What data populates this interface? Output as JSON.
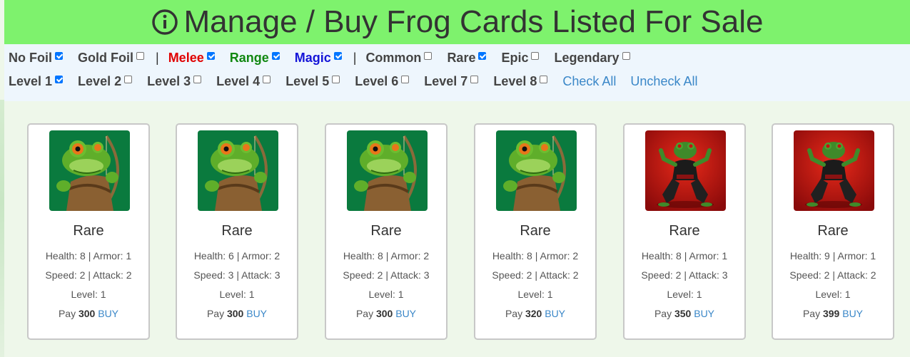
{
  "header": {
    "title": "Manage / Buy Frog Cards Listed For Sale",
    "icon": "info-circle-icon"
  },
  "filters": {
    "row1": [
      {
        "label": "No Foil",
        "checked": true,
        "color": "#444444"
      },
      {
        "label": "Gold Foil",
        "checked": false,
        "color": "#444444"
      },
      {
        "sep": "|"
      },
      {
        "label": "Melee",
        "checked": true,
        "color": "#e00000"
      },
      {
        "label": "Range",
        "checked": true,
        "color": "#118811"
      },
      {
        "label": "Magic",
        "checked": true,
        "color": "#1515d8"
      },
      {
        "sep": "|"
      },
      {
        "label": "Common",
        "checked": false,
        "color": "#444444"
      },
      {
        "label": "Rare",
        "checked": true,
        "color": "#444444"
      },
      {
        "label": "Epic",
        "checked": false,
        "color": "#444444"
      },
      {
        "label": "Legendary",
        "checked": false,
        "color": "#444444"
      }
    ],
    "row2": [
      {
        "label": "Level 1",
        "checked": true
      },
      {
        "label": "Level 2",
        "checked": false
      },
      {
        "label": "Level 3",
        "checked": false
      },
      {
        "label": "Level 4",
        "checked": false
      },
      {
        "label": "Level 5",
        "checked": false
      },
      {
        "label": "Level 6",
        "checked": false
      },
      {
        "label": "Level 7",
        "checked": false
      },
      {
        "label": "Level 8",
        "checked": false
      }
    ],
    "check_all": "Check All",
    "uncheck_all": "Uncheck All"
  },
  "cards": [
    {
      "art": "archer-frog-icon",
      "rarity": "Rare",
      "health_armor": "Health: 8 | Armor: 1",
      "speed_attack": "Speed: 2 | Attack: 2",
      "level": "Level: 1",
      "pay_label": "Pay",
      "price": "300",
      "buy": "BUY"
    },
    {
      "art": "archer-frog-icon",
      "rarity": "Rare",
      "health_armor": "Health: 6 | Armor: 2",
      "speed_attack": "Speed: 3 | Attack: 3",
      "level": "Level: 1",
      "pay_label": "Pay",
      "price": "300",
      "buy": "BUY"
    },
    {
      "art": "archer-frog-icon",
      "rarity": "Rare",
      "health_armor": "Health: 8 | Armor: 2",
      "speed_attack": "Speed: 2 | Attack: 3",
      "level": "Level: 1",
      "pay_label": "Pay",
      "price": "300",
      "buy": "BUY"
    },
    {
      "art": "archer-frog-icon",
      "rarity": "Rare",
      "health_armor": "Health: 8 | Armor: 2",
      "speed_attack": "Speed: 2 | Attack: 2",
      "level": "Level: 1",
      "pay_label": "Pay",
      "price": "320",
      "buy": "BUY"
    },
    {
      "art": "fighter-frog-icon",
      "rarity": "Rare",
      "health_armor": "Health: 8 | Armor: 1",
      "speed_attack": "Speed: 2 | Attack: 3",
      "level": "Level: 1",
      "pay_label": "Pay",
      "price": "350",
      "buy": "BUY"
    },
    {
      "art": "fighter-frog-icon",
      "rarity": "Rare",
      "health_armor": "Health: 9 | Armor: 1",
      "speed_attack": "Speed: 2 | Attack: 2",
      "level": "Level: 1",
      "pay_label": "Pay",
      "price": "399",
      "buy": "BUY"
    }
  ],
  "colors": {
    "header_bg": "#7ef26d",
    "link": "#3a87c8",
    "checkbox_on": "#0075ff"
  }
}
